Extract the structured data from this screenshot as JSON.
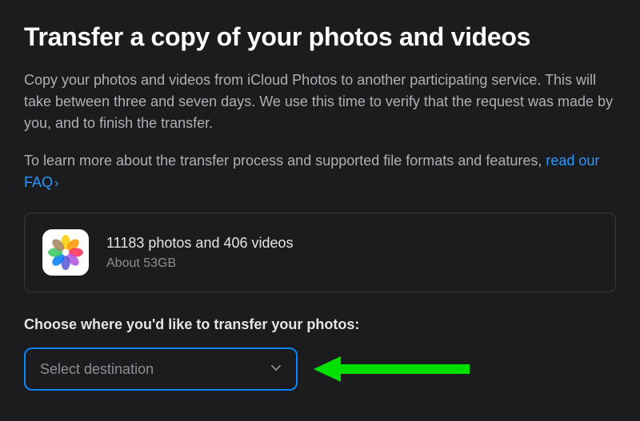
{
  "title": "Transfer a copy of your photos and videos",
  "description": "Copy your photos and videos from iCloud Photos to another participating service. This will take between three and seven days. We use this time to verify that the request was made by you, and to finish the transfer.",
  "faq": {
    "prefix": "To learn more about the transfer process and supported file formats and features, ",
    "link_text": "read our FAQ",
    "chevron": "›"
  },
  "summary": {
    "count_text": "11183 photos and 406 videos",
    "size_text": "About 53GB",
    "icon_name": "photos-app-icon"
  },
  "choose_label": "Choose where you'd like to transfer your photos:",
  "destination": {
    "placeholder": "Select destination"
  },
  "colors": {
    "accent": "#0a84ff",
    "link": "#2997ff",
    "annotation_arrow": "#00e000"
  }
}
